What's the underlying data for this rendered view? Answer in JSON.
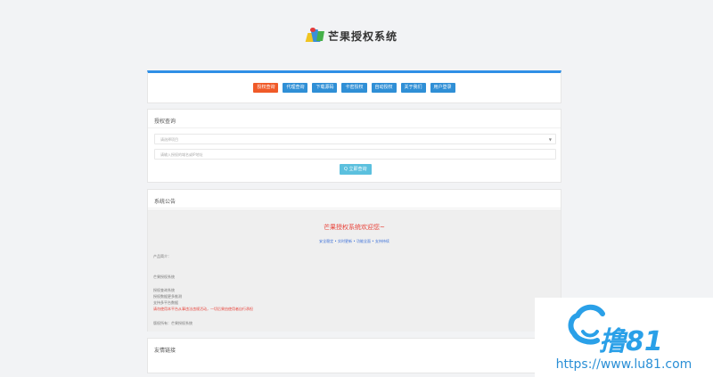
{
  "header": {
    "logo_text": "芒果授权系统"
  },
  "nav": {
    "buttons": [
      "授权查询",
      "代理查询",
      "下载源码",
      "卡密授权",
      "自动授权",
      "关于我们",
      "用户登录"
    ]
  },
  "query": {
    "title": "授权查询",
    "select_placeholder": "请选择项目",
    "input_placeholder": "请输入授权的域名或IP地址",
    "button_label": "Q 立即查询"
  },
  "notice": {
    "title": "系统公告",
    "welcome": "芒果授权系统欢迎您~",
    "features": "安全稳定 • 实时更新 • 功能全面 • 支持持续",
    "lines": [
      "产品简介：",
      "芒果授权系统",
      "授权查询系统",
      "授权数据更多推测",
      "支持多平台数据",
      "请勿使用本平台从事违法违规活动，一切后果由使用者自行承担",
      "版权所有：芒果授权系统"
    ]
  },
  "links": {
    "title": "友情链接"
  },
  "watermark": {
    "brand": "撸81",
    "url": "https://www.lu81.com"
  },
  "colors": {
    "accent": "#2f8fe6",
    "nav_active": "#f05a28",
    "nav_button": "#2f8fd6",
    "query_button": "#5bc0de",
    "notice_red": "#e8433a",
    "notice_blue": "#3b6fd8"
  }
}
